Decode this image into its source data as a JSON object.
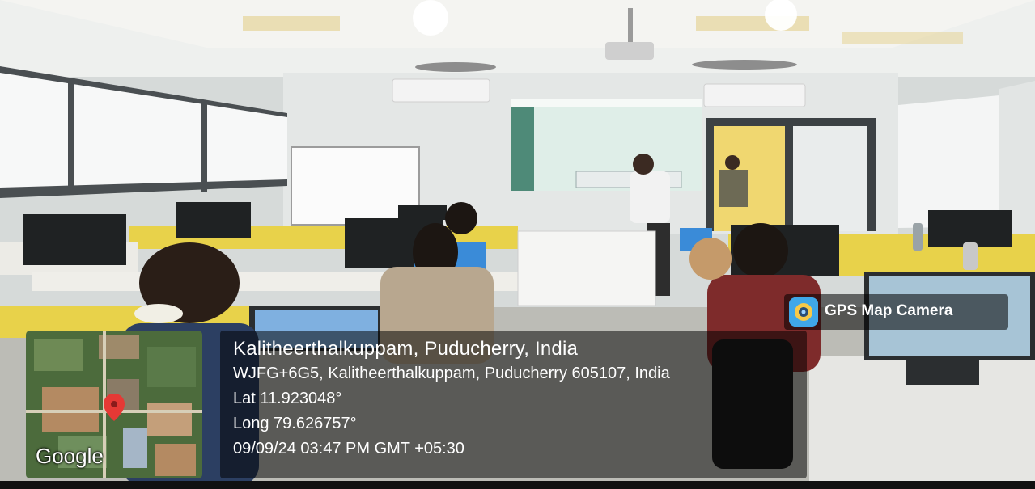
{
  "overlay": {
    "location_title": "Kalitheerthalkuppam, Puducherry, India",
    "address": "WJFG+6G5, Kalitheerthalkuppam, Puducherry 605107, India",
    "latitude": "Lat 11.923048°",
    "longitude": "Long 79.626757°",
    "timestamp": "09/09/24 03:47 PM GMT +05:30"
  },
  "map": {
    "logo": "Google",
    "pin_color": "#e53935"
  },
  "badge": {
    "label": "GPS Map Camera",
    "icon": "camera-icon",
    "icon_color": "#3fa7e8"
  },
  "colors": {
    "desk_yellow": "#e8d24a",
    "wall": "#e9ecec",
    "floor": "#bcbcb6",
    "projection": "#dfeee8"
  }
}
